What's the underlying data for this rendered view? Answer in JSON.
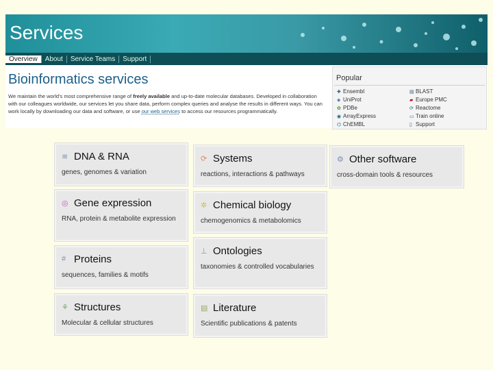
{
  "banner": {
    "title": "Services",
    "subnav": [
      "Overview",
      "About",
      "Service Teams",
      "Support"
    ]
  },
  "intro": {
    "heading": "Bioinformatics services",
    "para_1": "We maintain the world's most comprehensive range of",
    "para_bold_1": "freely available",
    "para_2": "and up-to-date molecular databases. Developed in collaboration with our colleagues worldwide, our services let you share data, perform complex queries and analyse the results in different ways. You can work locally by downloading our data and software, or use",
    "para_link": "our web services",
    "para_3": "to access our resources programmatically."
  },
  "popular": {
    "title": "Popular",
    "left": [
      "Ensembl",
      "UniProt",
      "PDBe",
      "ArrayExpress",
      "ChEMBL"
    ],
    "right": [
      "BLAST",
      "Europe PMC",
      "Reactome",
      "Train online",
      "Support"
    ]
  },
  "tiles": {
    "dna": {
      "title": "DNA & RNA",
      "desc": "genes, genomes & variation"
    },
    "systems": {
      "title": "Systems",
      "desc": "reactions, interactions & pathways"
    },
    "other": {
      "title": "Other software",
      "desc": "cross-domain tools & resources"
    },
    "expression": {
      "title": "Gene expression",
      "desc": "RNA, protein & metabolite expression"
    },
    "chemical": {
      "title": "Chemical biology",
      "desc": "chemogenomics & metabolomics"
    },
    "ontologies": {
      "title": "Ontologies",
      "desc": "taxonomies & controlled vocabularies"
    },
    "proteins": {
      "title": "Proteins",
      "desc": "sequences, families & motifs"
    },
    "structures": {
      "title": "Structures",
      "desc": "Molecular & cellular structures"
    },
    "literature": {
      "title": "Literature",
      "desc": "Scientific publications & patents"
    }
  },
  "icons": {
    "dna": "dna-icon",
    "systems": "cycle-icon",
    "other": "tools-icon",
    "expression": "expression-icon",
    "chemical": "chemical-icon",
    "ontologies": "tree-icon",
    "proteins": "grid-icon",
    "structures": "structure-icon",
    "literature": "document-icon"
  }
}
